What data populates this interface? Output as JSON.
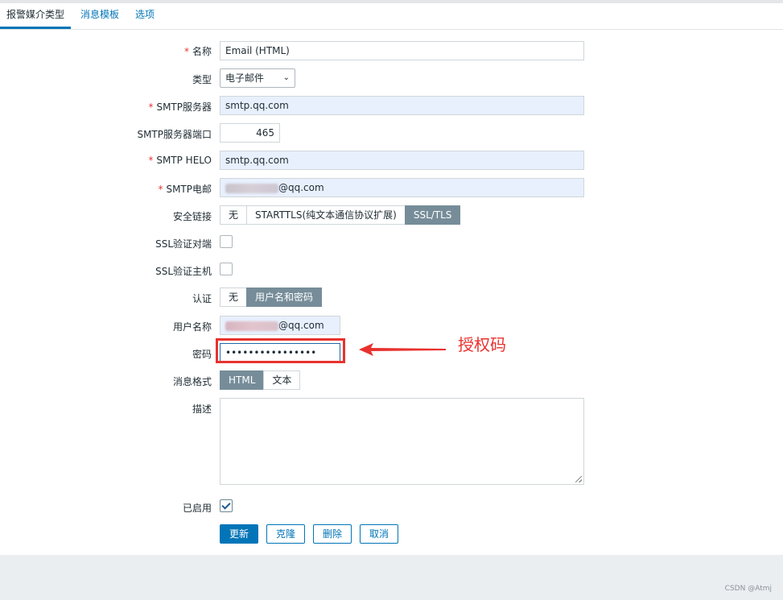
{
  "tabs": [
    {
      "label": "报警媒介类型",
      "active": true
    },
    {
      "label": "消息模板",
      "active": false
    },
    {
      "label": "选项",
      "active": false
    }
  ],
  "form": {
    "name": {
      "label": "名称",
      "required": true,
      "value": "Email (HTML)"
    },
    "type": {
      "label": "类型",
      "value": "电子邮件"
    },
    "smtp_server": {
      "label": "SMTP服务器",
      "required": true,
      "value": "smtp.qq.com"
    },
    "smtp_port": {
      "label": "SMTP服务器端口",
      "value": "465"
    },
    "smtp_helo": {
      "label": "SMTP HELO",
      "required": true,
      "value": "smtp.qq.com"
    },
    "smtp_email": {
      "label": "SMTP电邮",
      "required": true,
      "value_suffix": "@qq.com"
    },
    "security": {
      "label": "安全链接",
      "options": [
        "无",
        "STARTTLS(纯文本通信协议扩展)",
        "SSL/TLS"
      ],
      "selected": "SSL/TLS"
    },
    "ssl_verify_peer": {
      "label": "SSL验证对端",
      "checked": false
    },
    "ssl_verify_host": {
      "label": "SSL验证主机",
      "checked": false
    },
    "auth": {
      "label": "认证",
      "options": [
        "无",
        "用户名和密码"
      ],
      "selected": "用户名和密码"
    },
    "username": {
      "label": "用户名称",
      "value_suffix": "@qq.com"
    },
    "password": {
      "label": "密码",
      "value": "••••••••••••••••"
    },
    "message_format": {
      "label": "消息格式",
      "options": [
        "HTML",
        "文本"
      ],
      "selected": "HTML"
    },
    "description": {
      "label": "描述",
      "value": ""
    },
    "enabled": {
      "label": "已启用",
      "checked": true
    }
  },
  "buttons": {
    "update": "更新",
    "clone": "克隆",
    "delete": "删除",
    "cancel": "取消"
  },
  "annotation": {
    "text": "授权码",
    "color": "#e8322e"
  },
  "footer": {
    "watermark": "CSDN @Atmj"
  },
  "colors": {
    "accent": "#0275b8",
    "required": "#e33734",
    "segment_selected": "#768d99"
  }
}
